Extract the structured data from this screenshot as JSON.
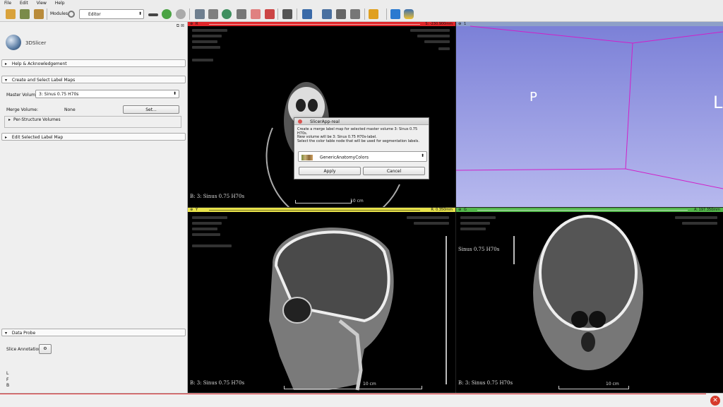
{
  "menu": [
    "File",
    "Edit",
    "View",
    "Help"
  ],
  "toolbar": {
    "modules_label": "Modules:",
    "module_selected": "Editor"
  },
  "app": {
    "logo_text": "3DSlicer"
  },
  "sections": {
    "help": "Help & Acknowledgement",
    "create": "Create and Select Label Maps",
    "edit": "Edit Selected Label Map",
    "data_probe": "Data Probe"
  },
  "create": {
    "master_label": "Master Volume:",
    "master_value": "3: Sinus  0.75  H70s",
    "merge_label": "Merge Volume:",
    "merge_value": "None",
    "set_button": "Set...",
    "per_structure": "Per-Structure Volumes"
  },
  "probe": {
    "slice_annotations": "Slice Annotations:",
    "lines": [
      "L",
      "F",
      "B"
    ]
  },
  "views": {
    "red": {
      "letter": "R",
      "offset": "S: -230.900mm",
      "label": "B: 3: Sinus  0.75  H70s",
      "scale": "10 cm"
    },
    "threeD": {
      "letter": "1",
      "p": "P",
      "l": "L"
    },
    "yellow": {
      "letter": "Y",
      "offset": "R: 0.350mm",
      "label": "B: 3: Sinus  0.75  H70s",
      "scale": "10 cm"
    },
    "green": {
      "letter": "G",
      "offset": "A: 197.350mm",
      "label": "B: 3: Sinus  0.75  H70s",
      "scale": "10 cm",
      "series": "Sinus  0.75  H70s"
    }
  },
  "dialog": {
    "title": "SlicerApp-real",
    "line1": "Create a merge label map for selected master volume 3: Sinus  0.75  H70s.",
    "line2": "New volume will be 3: Sinus  0.75  H70s-label.",
    "line3": "Select the color table node that will be used for segmentation labels.",
    "color_table": "GenericAnatomyColors",
    "apply": "Apply",
    "cancel": "Cancel"
  },
  "colors": {
    "red": "#e0262a",
    "yellow": "#e7e24a",
    "green": "#53b74b",
    "error": "#d63a2b"
  }
}
